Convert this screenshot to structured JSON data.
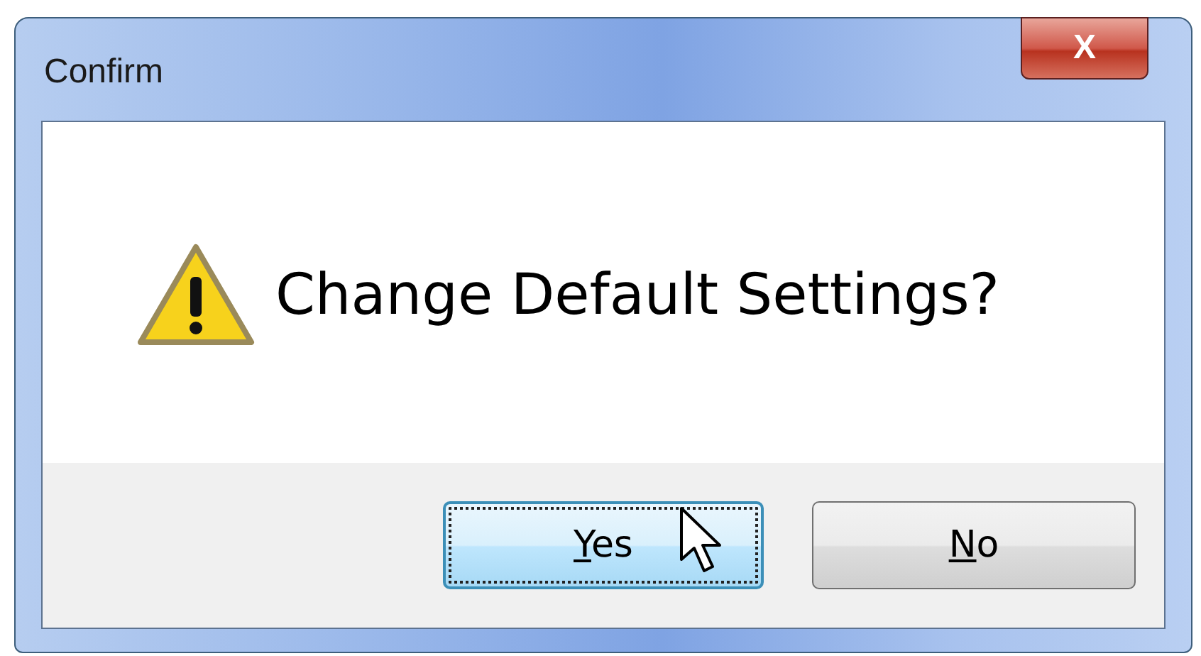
{
  "window": {
    "title": "Confirm",
    "close_label": "X"
  },
  "message": "Change Default Settings?",
  "buttons": [
    {
      "label": "Yes",
      "focused": true
    },
    {
      "label": "No",
      "focused": false
    }
  ]
}
